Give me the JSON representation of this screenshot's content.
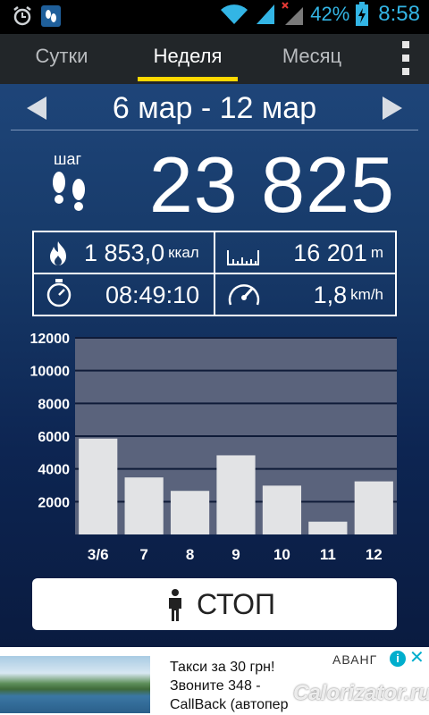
{
  "status_bar": {
    "battery_percent": "42%",
    "time": "8:58",
    "icons": [
      "alarm-icon",
      "pedometer-app-icon",
      "wifi-icon",
      "signal-icon",
      "signal-no-data-icon",
      "battery-charging-icon"
    ]
  },
  "tabs": [
    {
      "label": "Сутки",
      "active": false
    },
    {
      "label": "Неделя",
      "active": true
    },
    {
      "label": "Месяц",
      "active": false
    }
  ],
  "date_range": "6 мар - 12 мар",
  "steps": {
    "label": "шаг",
    "value": "23 825"
  },
  "stats": {
    "calories": {
      "value": "1 853,0",
      "unit": "ккал",
      "icon": "flame-icon"
    },
    "distance": {
      "value": "16 201",
      "unit": "m",
      "icon": "ruler-icon"
    },
    "duration": {
      "value": "08:49:10",
      "icon": "stopwatch-icon"
    },
    "speed": {
      "value": "1,8",
      "unit": "km/h",
      "icon": "speedometer-icon"
    }
  },
  "chart_data": {
    "type": "bar",
    "categories": [
      "3/6",
      "7",
      "8",
      "9",
      "10",
      "11",
      "12"
    ],
    "values": [
      5850,
      3480,
      2660,
      4830,
      2980,
      780,
      3240
    ],
    "yticks": [
      2000,
      4000,
      6000,
      8000,
      10000,
      12000
    ],
    "ylim": [
      0,
      12000
    ],
    "grid": true,
    "colors": {
      "bar": "#e2e3e5",
      "plot_bg": "#5a637c",
      "grid": "#0f1b38",
      "ticks": "#ffffff"
    }
  },
  "stop_button": {
    "label": "СТОП",
    "icon": "person-icon"
  },
  "ad": {
    "lines": [
      "Такси за 30 грн!",
      "Звоните 348 -",
      "CallBack (автопер"
    ],
    "brand": "АВАНГ",
    "info": "i",
    "close": "✕",
    "watermark": "Calorizator.ru"
  },
  "colors": {
    "accent": "#ffd800",
    "status_blue": "#33b5e5",
    "tab_bg": "#222629",
    "main_bg_top": "#1e4579",
    "main_bg_bottom": "#0a1b40"
  }
}
